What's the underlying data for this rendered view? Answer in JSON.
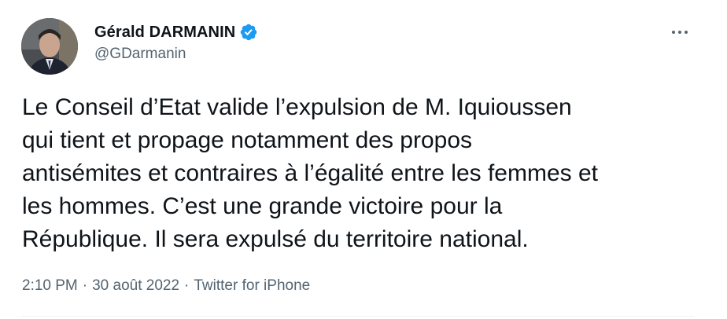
{
  "author": {
    "display_name": "Gérald DARMANIN",
    "handle": "@GDarmanin",
    "verified": true,
    "verified_color": "#1d9bf0"
  },
  "tweet": {
    "text": "Le Conseil d’Etat valide l’expulsion de M. Iquioussen\nqui tient et propage notamment des propos\nantisémites et contraires à l’égalité entre les femmes et\nles hommes. C’est une grande victoire pour la\nRépublique. Il sera expulsé du territoire national.",
    "time": "2:10 PM",
    "separator": "·",
    "date": "30 août 2022",
    "source": "Twitter for iPhone"
  },
  "icons": {
    "more": "more-horizontal-icon",
    "verified": "verified-badge-icon"
  },
  "colors": {
    "text_primary": "#0f1419",
    "text_secondary": "#536471",
    "divider": "#eff3f4"
  }
}
